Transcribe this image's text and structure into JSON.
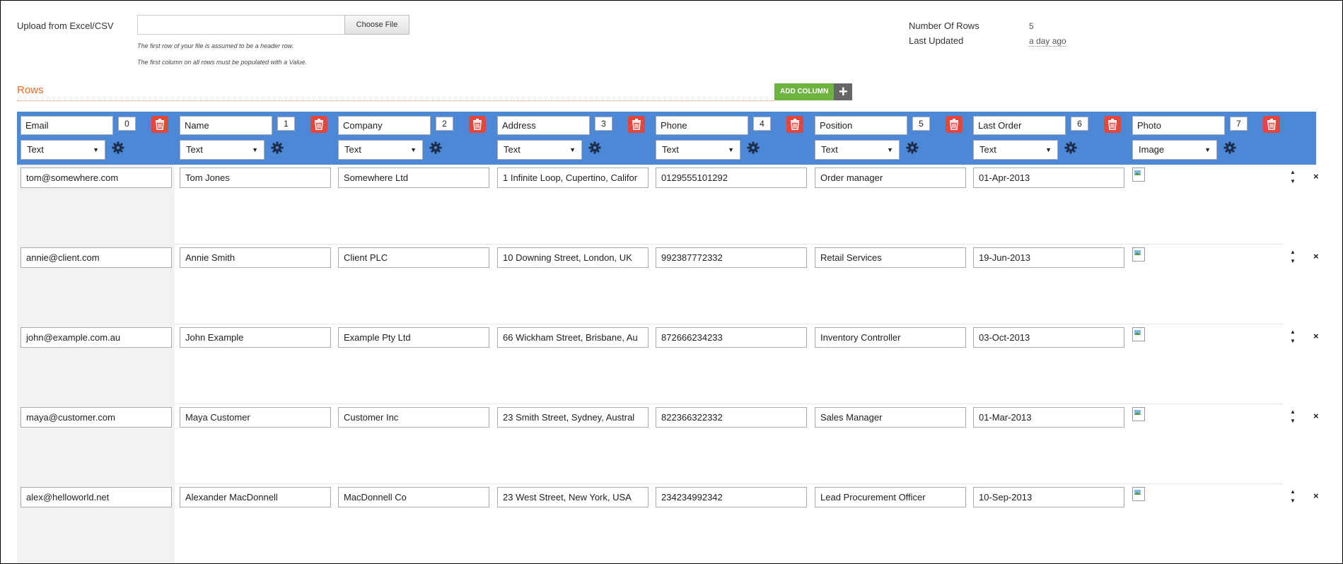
{
  "upload": {
    "label": "Upload from Excel/CSV",
    "choose_file": "Choose File",
    "hint1": "The first row of your file is assumed to be a header row.",
    "hint2": "The first column on all rows must be populated with a Value."
  },
  "meta": {
    "rows_label": "Number Of Rows",
    "rows_value": "5",
    "updated_label": "Last Updated",
    "updated_value": "a day ago"
  },
  "section": {
    "title": "Rows",
    "add_column": "ADD COLUMN",
    "add_icon": "plus-icon"
  },
  "columns": [
    {
      "name": "Email",
      "index": "0",
      "type": "Text"
    },
    {
      "name": "Name",
      "index": "1",
      "type": "Text"
    },
    {
      "name": "Company",
      "index": "2",
      "type": "Text"
    },
    {
      "name": "Address",
      "index": "3",
      "type": "Text"
    },
    {
      "name": "Phone",
      "index": "4",
      "type": "Text"
    },
    {
      "name": "Position",
      "index": "5",
      "type": "Text"
    },
    {
      "name": "Last Order",
      "index": "6",
      "type": "Text"
    },
    {
      "name": "Photo",
      "index": "7",
      "type": "Image"
    }
  ],
  "rows": [
    [
      "tom@somewhere.com",
      "Tom Jones",
      "Somewhere Ltd",
      "1 Infinite Loop, Cupertino, Califor",
      "0129555101292",
      "Order manager",
      "01-Apr-2013"
    ],
    [
      "annie@client.com",
      "Annie Smith",
      "Client PLC",
      "10 Downing Street, London, UK",
      "992387772332",
      "Retail Services",
      "19-Jun-2013"
    ],
    [
      "john@example.com.au",
      "John Example",
      "Example Pty Ltd",
      "66 Wickham Street, Brisbane, Au",
      "872666234233",
      "Inventory Controller",
      "03-Oct-2013"
    ],
    [
      "maya@customer.com",
      "Maya Customer",
      "Customer Inc",
      "23 Smith Street, Sydney, Austral",
      "822366322332",
      "Sales Manager",
      "01-Mar-2013"
    ],
    [
      "alex@helloworld.net",
      "Alexander MacDonnell",
      "MacDonnell Co",
      "23 West Street, New York, USA",
      "234234992342",
      "Lead Procurement Officer",
      "10-Sep-2013"
    ]
  ],
  "colors": {
    "header_band": "#4c88d6",
    "accent_orange": "#f06a1d",
    "add_green": "#6db33f",
    "delete_red": "#e2463c"
  },
  "glyphs": {
    "sort_up": "▲",
    "sort_down": "▼",
    "remove": "×",
    "caret": "▼"
  }
}
